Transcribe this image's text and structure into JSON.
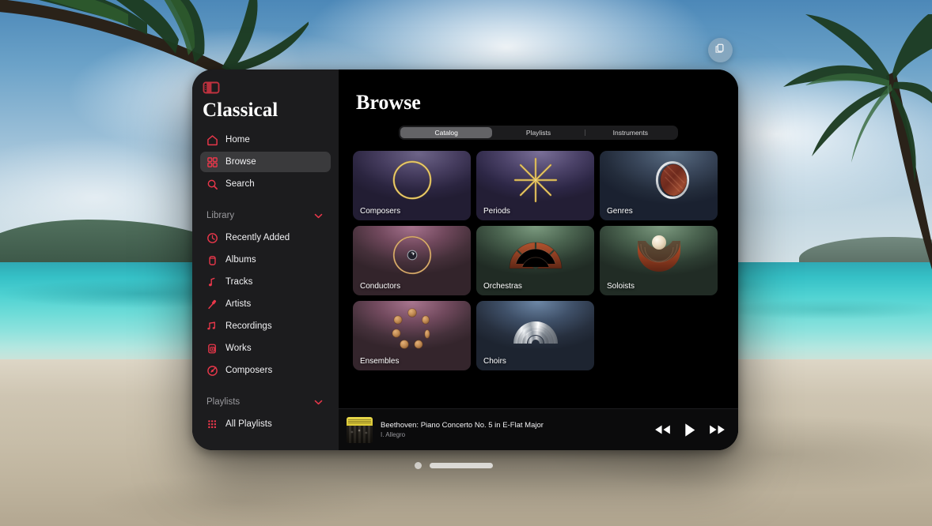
{
  "window_controls": {
    "resize_chip_icon": "window-resize-icon",
    "page_dot": "page-indicator-dot",
    "grab_bar": "window-grab-bar"
  },
  "sidebar": {
    "toggle_icon": "sidebar-toggle-icon",
    "app_title": "Classical",
    "top_items": [
      {
        "label": "Home",
        "icon": "home-icon",
        "active": false
      },
      {
        "label": "Browse",
        "icon": "grid-icon",
        "active": true
      },
      {
        "label": "Search",
        "icon": "search-icon",
        "active": false
      }
    ],
    "sections": [
      {
        "title": "Library",
        "chevron": "chevron-down-icon",
        "items": [
          {
            "label": "Recently Added",
            "icon": "clock-icon"
          },
          {
            "label": "Albums",
            "icon": "album-icon"
          },
          {
            "label": "Tracks",
            "icon": "music-note-icon"
          },
          {
            "label": "Artists",
            "icon": "microphone-icon"
          },
          {
            "label": "Recordings",
            "icon": "double-note-icon"
          },
          {
            "label": "Works",
            "icon": "works-icon"
          },
          {
            "label": "Composers",
            "icon": "composer-icon"
          }
        ]
      },
      {
        "title": "Playlists",
        "chevron": "chevron-down-icon",
        "items": [
          {
            "label": "All Playlists",
            "icon": "playlist-grid-icon"
          }
        ]
      }
    ]
  },
  "main": {
    "page_title": "Browse",
    "tabs": [
      {
        "label": "Catalog",
        "active": true
      },
      {
        "label": "Playlists",
        "active": false
      },
      {
        "label": "Instruments",
        "active": false
      }
    ],
    "cards": [
      {
        "label": "Composers",
        "art": "gold-ring"
      },
      {
        "label": "Periods",
        "art": "gold-starburst"
      },
      {
        "label": "Genres",
        "art": "wood-disc-silver-ring"
      },
      {
        "label": "Conductors",
        "art": "gold-ring-baton-orb"
      },
      {
        "label": "Orchestras",
        "art": "wood-fan-segments"
      },
      {
        "label": "Soloists",
        "art": "wood-arc-pearl"
      },
      {
        "label": "Ensembles",
        "art": "bronze-coin-circle"
      },
      {
        "label": "Choirs",
        "art": "silver-dome-shell"
      }
    ]
  },
  "player": {
    "artwork_label": "album-artwork",
    "title": "Beethoven: Piano Concerto No. 5 in E-Flat Major",
    "subtitle": "I. Allegro",
    "controls": [
      {
        "name": "previous-button",
        "icon": "rewind-icon"
      },
      {
        "name": "play-button",
        "icon": "play-icon"
      },
      {
        "name": "next-button",
        "icon": "fast-forward-icon"
      }
    ]
  },
  "colors": {
    "accent": "#e8374a",
    "window_bg": "#000000",
    "sidebar_bg": "#1c1c1e",
    "active_nav_bg": "#3a3a3c",
    "segment_active": "#636366"
  }
}
